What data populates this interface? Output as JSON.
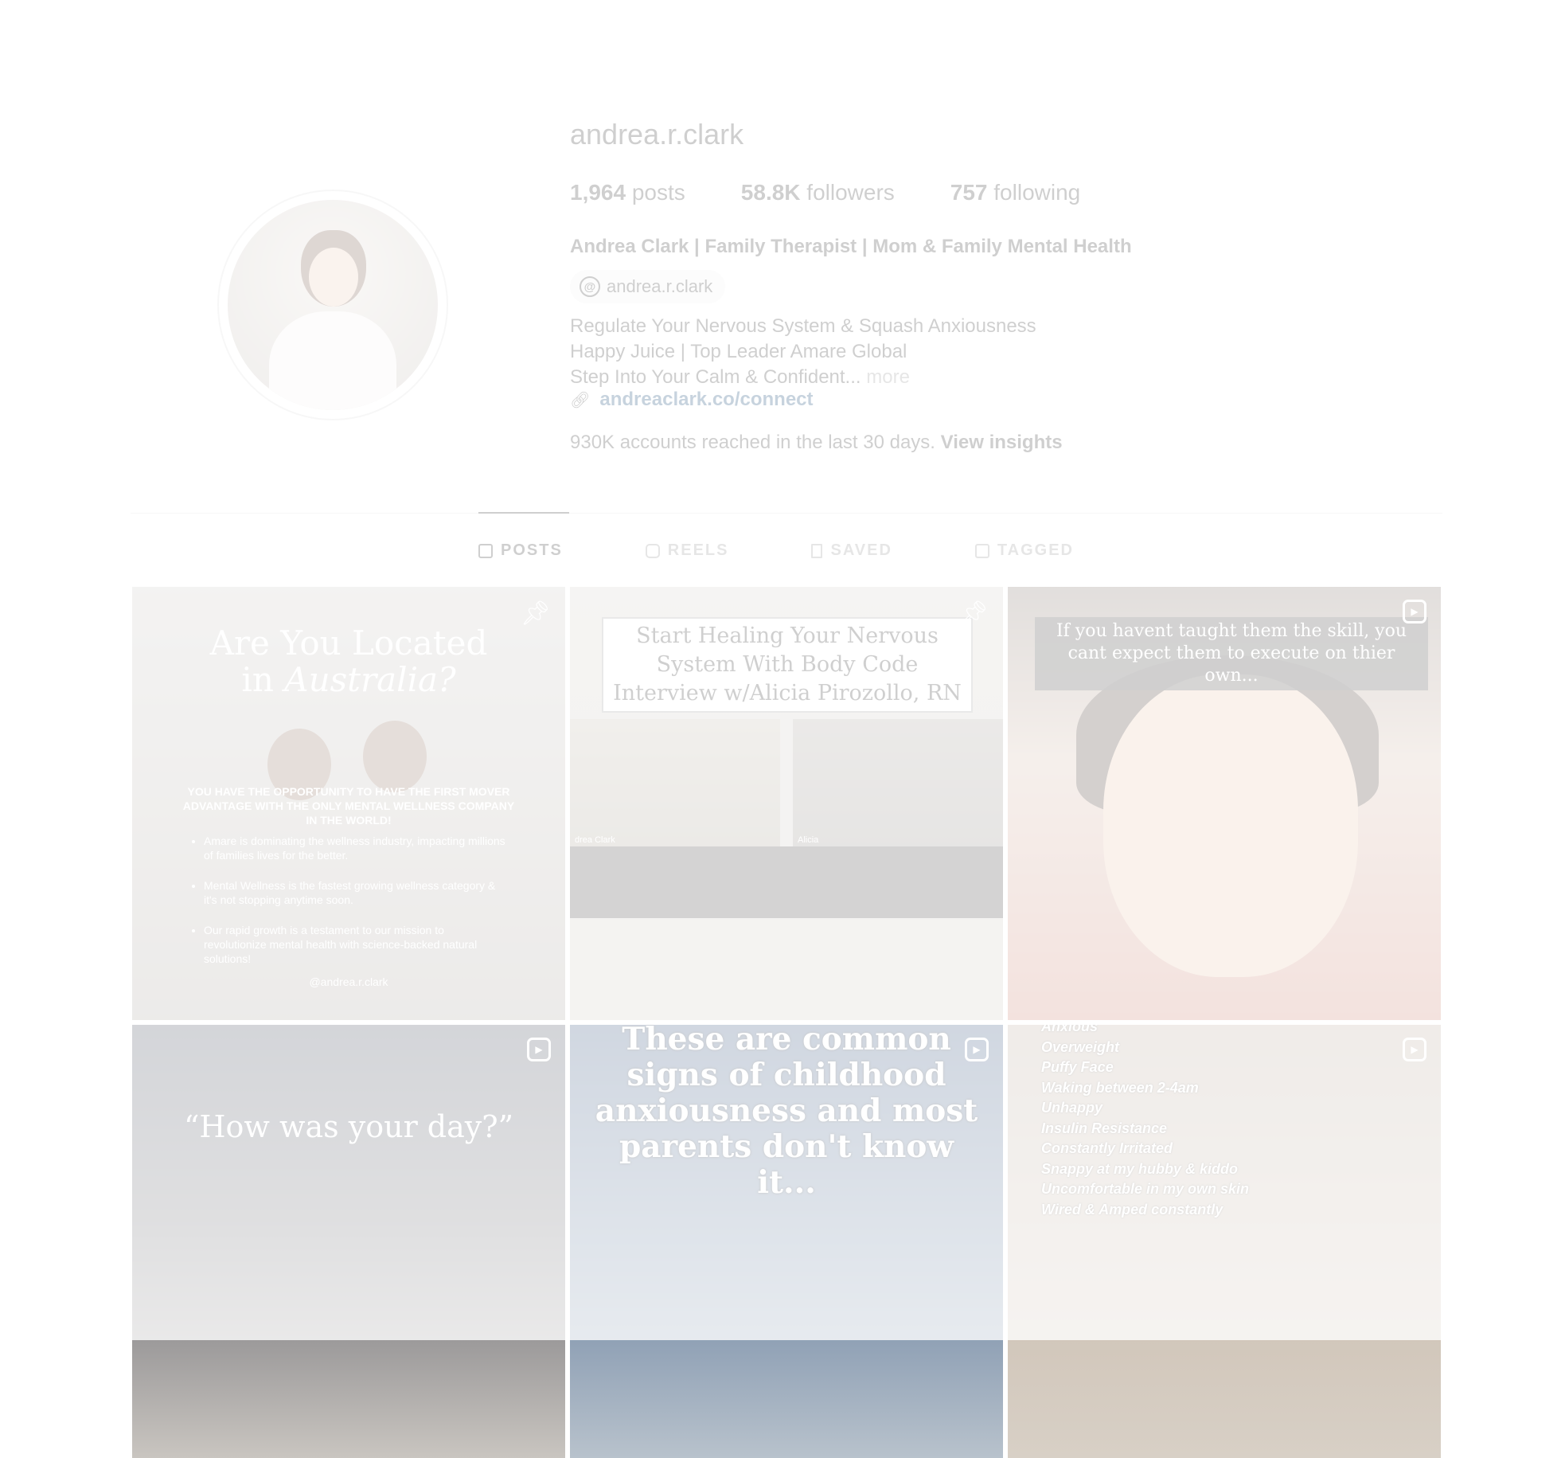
{
  "profile": {
    "username": "andrea.r.clark",
    "stats": {
      "posts_count": "1,964",
      "posts_label": "posts",
      "followers_count": "58.8K",
      "followers_label": "followers",
      "following_count": "757",
      "following_label": "following"
    },
    "full_name": "Andrea Clark | Family Therapist | Mom & Family Mental Health",
    "threads_handle": "andrea.r.clark",
    "bio_lines": [
      "Regulate Your Nervous System & Squash Anxiousness",
      "Happy Juice | Top Leader Amare Global",
      "Step Into Your Calm & Confident..."
    ],
    "bio_more": "more",
    "link": "andreaclark.co/connect",
    "reach_text": "930K accounts reached in the last 30 days.",
    "reach_link": "View insights"
  },
  "tabs": [
    {
      "label": "POSTS",
      "icon": "grid-icon",
      "active": true
    },
    {
      "label": "REELS",
      "icon": "reels-icon",
      "active": false
    },
    {
      "label": "SAVED",
      "icon": "bookmark-icon",
      "active": false
    },
    {
      "label": "TAGGED",
      "icon": "tagged-icon",
      "active": false
    }
  ],
  "posts": [
    {
      "badge": "pin-icon",
      "title_line1": "Are You Located",
      "title_line2a": "in ",
      "title_line2b": "Australia?",
      "caps": "YOU HAVE THE OPPORTUNITY TO HAVE THE FIRST MOVER ADVANTAGE WITH THE ONLY MENTAL WELLNESS COMPANY IN THE WORLD!",
      "bullets": [
        "Amare is dominating the wellness industry, impacting millions of families lives for the better.",
        "Mental Wellness is the fastest growing wellness category & it's not stopping anytime soon.",
        "Our rapid growth is a testament to our mission to revolutionize mental health with science-backed natural solutions!"
      ],
      "handle": "@andrea.r.clark"
    },
    {
      "badge": "pin-icon",
      "title": "Start Healing Your Nervous System With Body Code Interview w/Alicia Pirozollo, RN",
      "label_left": "drea Clark",
      "label_right": "Alicia"
    },
    {
      "badge": "reels-icon",
      "caption": "If you havent taught them the skill, you cant expect them to execute on thier own..."
    },
    {
      "badge": "reels-icon",
      "quote": "“How was your day?”"
    },
    {
      "badge": "reels-icon",
      "text": "These are common signs of childhood anxiousness and most parents don't know it..."
    },
    {
      "badge": "reels-icon",
      "lines": [
        "Anxious",
        "Overweight",
        "Puffy Face",
        "Waking between 2-4am",
        "Unhappy",
        "Insulin Resistance",
        "Constantly Irritated",
        "Snappy at my hubby & kiddo",
        "Uncomfortable in my own skin",
        "Wired & Amped constantly"
      ]
    }
  ],
  "colors": {
    "text": "#262626",
    "secondary": "#8e8e8e",
    "link": "#00376b",
    "divider": "#dbdbdb",
    "pill_bg": "#efefef"
  }
}
